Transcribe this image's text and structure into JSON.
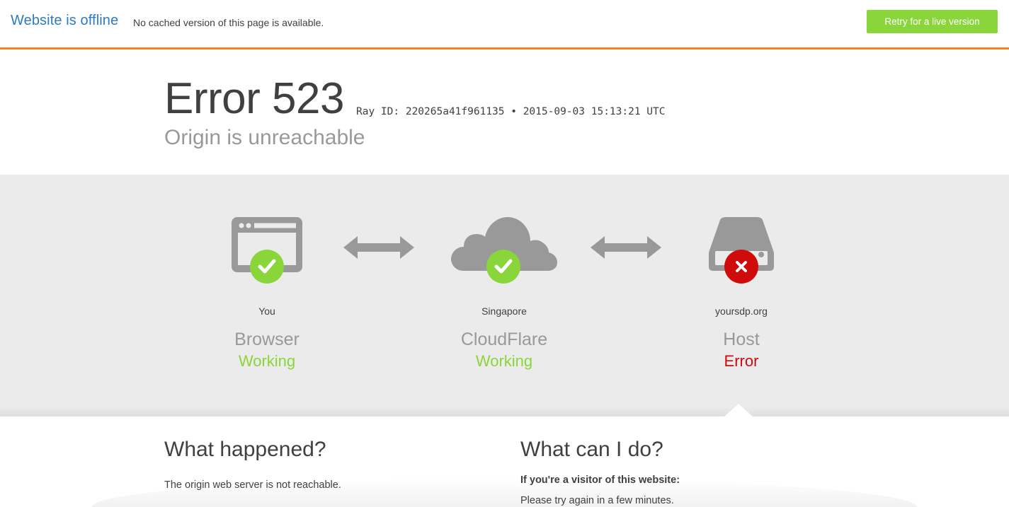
{
  "topbar": {
    "title": "Website is offline",
    "subtitle": "No cached version of this page is available.",
    "retry_label": "Retry for a live version",
    "accent_color": "#f6821f",
    "button_color": "#8ad53a",
    "title_color": "#2f7bbf"
  },
  "header": {
    "error_code": "Error 523",
    "ray_id_line": "Ray ID: 220265a41f961135 • 2015-09-03 15:13:21 UTC",
    "description": "Origin is unreachable"
  },
  "status": {
    "nodes": [
      {
        "location": "You",
        "name": "Browser",
        "state": "Working",
        "status": "ok",
        "icon": "browser-window-icon"
      },
      {
        "location": "Singapore",
        "name": "CloudFlare",
        "state": "Working",
        "status": "ok",
        "icon": "cloud-icon"
      },
      {
        "location": "yoursdp.org",
        "name": "Host",
        "state": "Error",
        "status": "error",
        "icon": "server-icon"
      }
    ],
    "colors": {
      "ok": "#8ad53a",
      "error": "#cf0c0b",
      "icon": "#999999"
    }
  },
  "info": {
    "what_happened": {
      "heading": "What happened?",
      "text": "The origin web server is not reachable."
    },
    "what_can_i_do": {
      "heading": "What can I do?",
      "visitor_label": "If you're a visitor of this website:",
      "visitor_text": "Please try again in a few minutes."
    }
  }
}
